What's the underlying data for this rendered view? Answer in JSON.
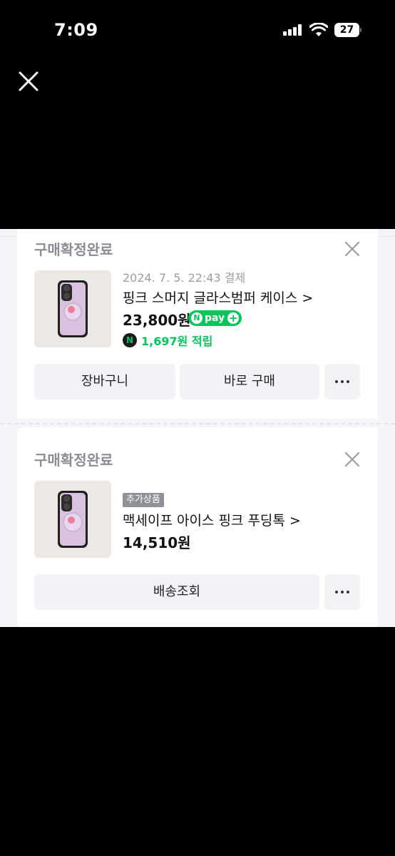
{
  "status_bar": {
    "time": "7:09",
    "battery": "27"
  },
  "orders": [
    {
      "status": "구매확정완료",
      "date": "2024. 7. 5. 22:43 결제",
      "product": "핑크 스머지 글라스범퍼 케이스 >",
      "price": "23,800원",
      "npay": "pay",
      "reward": "1,697원 적립",
      "buttons": {
        "cart": "장바구니",
        "buy_now": "바로 구매"
      }
    },
    {
      "status": "구매확정완료",
      "badge": "추가상품",
      "product": "맥세이프 아이스 핑크 푸딩톡 >",
      "price": "14,510원",
      "buttons": {
        "tracking": "배송조회"
      }
    }
  ],
  "colors": {
    "npay_green": "#03c75a",
    "sheet_bg": "#f4f5f8"
  }
}
